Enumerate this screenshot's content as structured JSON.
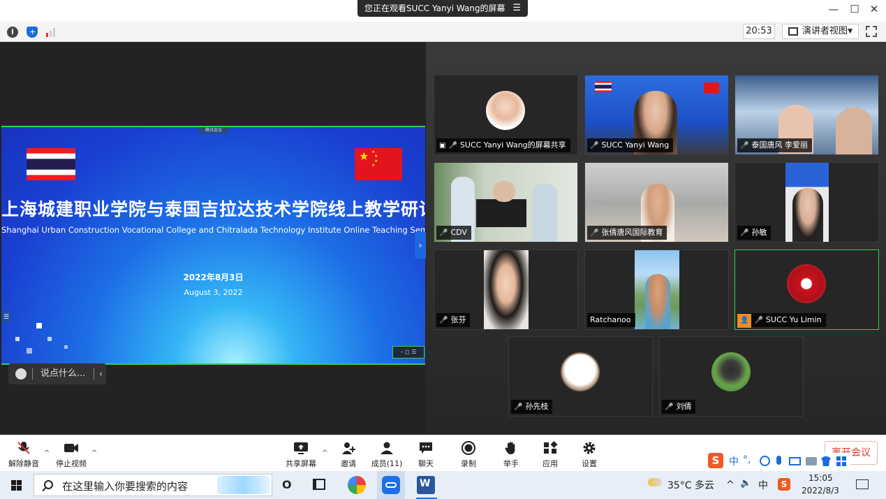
{
  "window": {
    "share_banner": "您正在观看SUCC Yanyi Wang的屏幕",
    "menu_icon": "☰",
    "minimize": "—",
    "maximize": "☐",
    "close": "✕"
  },
  "toolbar": {
    "clock": "20:53",
    "view_label": "演讲者视图",
    "view_caret": "▼"
  },
  "slide": {
    "tag": "腾讯会议",
    "title": "上海城建职业学院与泰国吉拉达技术学院线上教学研讨会",
    "subtitle": "Shanghai  Urban Construction Vocational College and Chitralada Technology Institute Online Teaching Seminar",
    "date_cn": "2022年8月3日",
    "date_en": "August 3, 2022",
    "corner_controls": "– ◻ ☰",
    "side_handle": "›",
    "left_handle": "☰"
  },
  "chat": {
    "placeholder": "说点什么...",
    "arrow": "‹"
  },
  "participants": [
    {
      "name": "SUCC Yanyi Wang的屏幕共享",
      "mic": "muted",
      "kind": "screen-share"
    },
    {
      "name": "SUCC Yanyi Wang",
      "mic": "muted",
      "kind": "video"
    },
    {
      "name": "泰国唐风 李爱丽",
      "mic": "on",
      "kind": "video"
    },
    {
      "name": "CDV",
      "mic": "on",
      "kind": "video"
    },
    {
      "name": "张倩唐风国际教育",
      "mic": "muted",
      "kind": "video"
    },
    {
      "name": "孙敏",
      "mic": "muted",
      "kind": "video"
    },
    {
      "name": "张芬",
      "mic": "muted",
      "kind": "video"
    },
    {
      "name": "Ratchanoo",
      "mic": "none",
      "kind": "video"
    },
    {
      "name": "SUCC Yu Limin",
      "mic": "on",
      "kind": "avatar",
      "active": true
    },
    {
      "name": "孙先枝",
      "mic": "muted",
      "kind": "avatar"
    },
    {
      "name": "刘倩",
      "mic": "muted",
      "kind": "avatar"
    }
  ],
  "bottom": {
    "unmute": "解除静音",
    "stop_video": "停止视频",
    "share_screen": "共享屏幕",
    "invite": "邀请",
    "members": "成员(11)",
    "chat": "聊天",
    "record": "录制",
    "raise_hand": "举手",
    "apps": "应用",
    "settings": "设置",
    "leave": "离开会议",
    "caret": "^"
  },
  "ime": {
    "logo": "S",
    "lang": "中",
    "punct": "°,"
  },
  "taskbar": {
    "search_placeholder": "在这里输入你要搜索的内容",
    "weather": "35°C 多云",
    "tray_arrow": "^",
    "volume": "🔈",
    "ime_lang": "中",
    "time": "15:05",
    "date": "2022/8/3",
    "task_view": "O"
  },
  "colors": {
    "accent_green": "#2fcf5e",
    "slide_blue": "#1a3fd0",
    "leave_red": "#e0392b",
    "mute_red": "#ff5a5a"
  }
}
